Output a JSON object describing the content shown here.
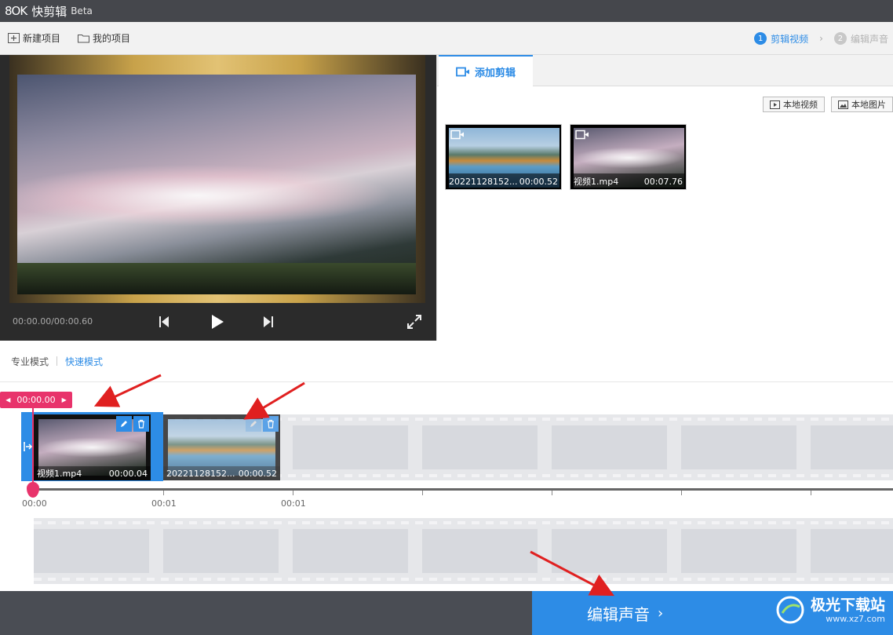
{
  "app": {
    "logo": "8OK",
    "name": "快剪辑",
    "badge": "Beta"
  },
  "toolbar": {
    "new_project": "新建项目",
    "my_projects": "我的项目",
    "steps": [
      {
        "num": "1",
        "label": "剪辑视频"
      },
      {
        "num": "2",
        "label": "编辑声音"
      }
    ]
  },
  "preview": {
    "time": "00:00.00/00:00.60"
  },
  "right_panel": {
    "tab": "添加剪辑",
    "local_video": "本地视频",
    "local_image": "本地图片",
    "media": [
      {
        "name": "20221128152...",
        "duration": "00:00.52"
      },
      {
        "name": "视频1.mp4",
        "duration": "00:07.76"
      }
    ]
  },
  "modes": {
    "pro": "专业模式",
    "fast": "快速模式"
  },
  "timeline": {
    "playhead": "00:00.00",
    "clips": [
      {
        "name": "视频1.mp4",
        "duration": "00:00.04"
      },
      {
        "name": "20221128152...",
        "duration": "00:00.52"
      }
    ],
    "ticks": [
      "00:00",
      "00:01",
      "00:01"
    ]
  },
  "bottom": {
    "next": "编辑声音",
    "watermark_title": "极光下载站",
    "watermark_url": "www.xz7.com"
  },
  "colors": {
    "accent": "#2d8ce6",
    "playhead": "#e8336b",
    "annotation": "#e02020"
  }
}
